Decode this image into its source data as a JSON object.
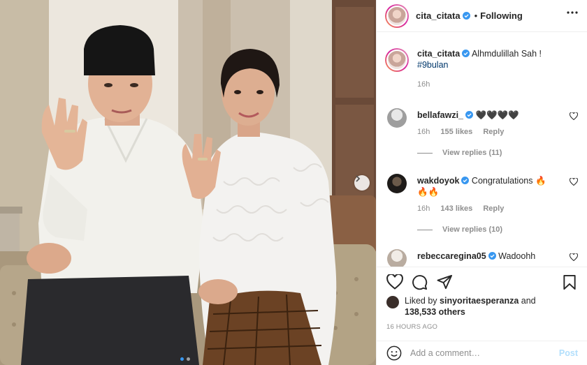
{
  "header": {
    "username": "cita_citata",
    "separator": "•",
    "follow_status": "Following",
    "more_icon": "more-horizontal-icon"
  },
  "caption": {
    "username": "cita_citata",
    "text": "Alhmdulillah Sah !",
    "hashtag": "#9bulan",
    "time": "16h"
  },
  "comments": [
    {
      "username": "bellafawzi_",
      "text": "🖤🖤🖤🖤",
      "time": "16h",
      "likes": "155 likes",
      "reply": "Reply",
      "view_replies": "View replies (11)"
    },
    {
      "username": "wakdoyok",
      "text": "Congratulations 🔥",
      "text2": "🔥🔥",
      "time": "16h",
      "likes": "143 likes",
      "reply": "Reply",
      "view_replies": "View replies (10)"
    },
    {
      "username": "rebeccaregina05",
      "text": "Wadoohh"
    }
  ],
  "actions": {
    "icons": [
      "heart-icon",
      "comment-icon",
      "share-icon",
      "bookmark-icon"
    ],
    "liked_prefix": "Liked by",
    "liked_user": "sinyoritaesperanza",
    "liked_and": "and",
    "liked_count": "138,533 others",
    "timestamp": "16 HOURS AGO"
  },
  "add_comment": {
    "placeholder": "Add a comment…",
    "post_label": "Post"
  },
  "carousel": {
    "slide_count": 2,
    "active_index": 0
  },
  "colors": {
    "verified": "#3897f0",
    "link": "#00376b",
    "muted": "#8e8e8e",
    "post_disabled": "#b2dffc"
  }
}
